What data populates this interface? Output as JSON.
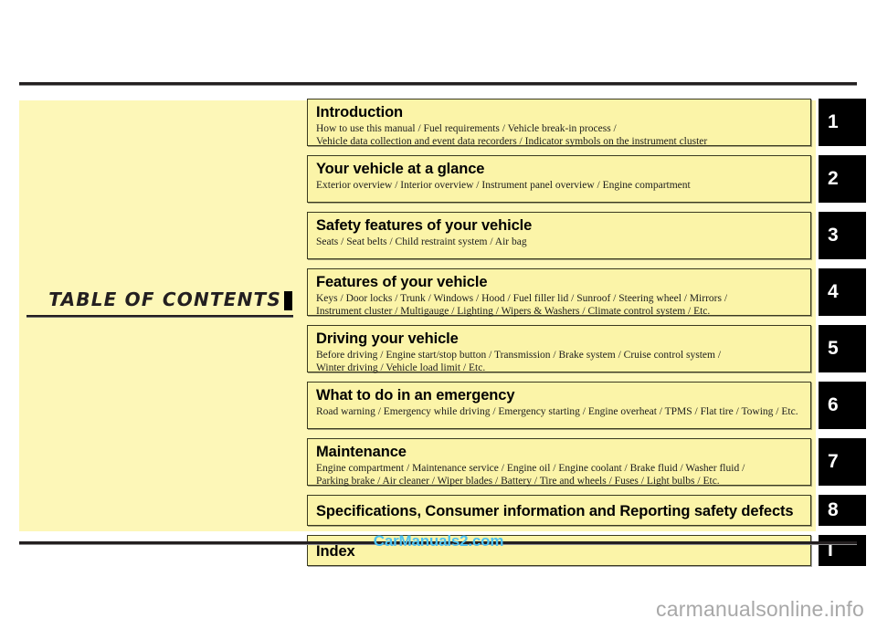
{
  "page": {
    "title": "TABLE  OF  CONTENTS",
    "background_color": "#ffffff",
    "panel_color": "#fdf7b8",
    "box_color": "#fbf4a8",
    "tab_color": "#000000",
    "rule_color": "#231f20"
  },
  "sections": [
    {
      "tab": "1",
      "heading": "Introduction",
      "sub_lines": [
        "How to use this manual / Fuel requirements / Vehicle break-in process /",
        "Vehicle data collection and event data recorders / Indicator symbols on the instrument cluster"
      ],
      "height": 52
    },
    {
      "tab": "2",
      "heading": "Your vehicle at a glance",
      "sub_lines": [
        "Exterior overview / Interior overview / Instrument panel overview / Engine compartment"
      ],
      "height": 52
    },
    {
      "tab": "3",
      "heading": "Safety features of your vehicle",
      "sub_lines": [
        "Seats / Seat belts / Child restraint system / Air bag"
      ],
      "height": 52
    },
    {
      "tab": "4",
      "heading": "Features of your vehicle",
      "sub_lines": [
        "Keys / Door locks / Trunk / Windows / Hood / Fuel filler lid / Sunroof / Steering wheel / Mirrors /",
        "Instrument cluster / Multigauge / Lighting / Wipers & Washers / Climate control system / Etc."
      ],
      "height": 52
    },
    {
      "tab": "5",
      "heading": "Driving your vehicle",
      "sub_lines": [
        "Before driving / Engine start/stop button / Transmission / Brake system / Cruise control system /",
        "Winter driving / Vehicle load limit / Etc."
      ],
      "height": 52
    },
    {
      "tab": "6",
      "heading": "What to do in an emergency",
      "sub_lines": [
        "Road warning / Emergency while driving / Emergency starting / Engine overheat / TPMS / Flat tire / Towing / Etc."
      ],
      "height": 52
    },
    {
      "tab": "7",
      "heading": "Maintenance",
      "sub_lines": [
        "Engine compartment / Maintenance service / Engine oil / Engine coolant / Brake fluid / Washer fluid /",
        "Parking brake / Air cleaner / Wiper blades / Battery / Tire and wheels / Fuses / Light bulbs / Etc."
      ],
      "height": 52
    },
    {
      "tab": "8",
      "heading": "Specifications, Consumer information and Reporting safety defects",
      "sub_lines": [],
      "height": 34
    },
    {
      "tab": "I",
      "heading": "Index",
      "sub_lines": [],
      "height": 34
    }
  ],
  "watermarks": {
    "center": "CarManuals2.com",
    "corner": "carmanualsonline.info"
  }
}
